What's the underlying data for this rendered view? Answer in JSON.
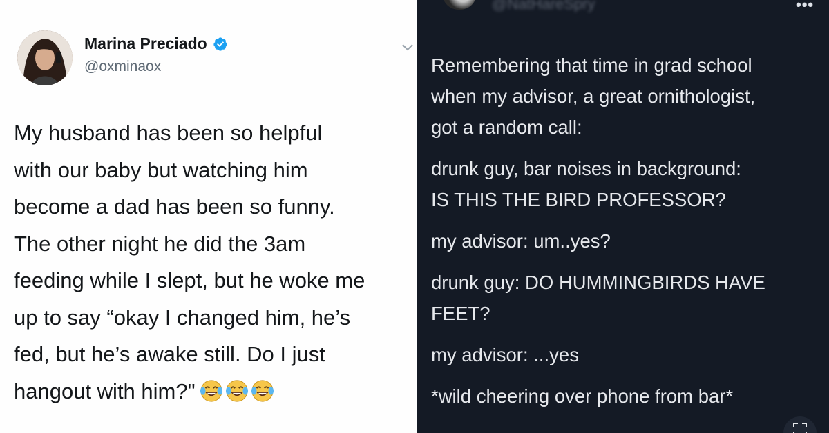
{
  "left_tweet": {
    "display_name": "Marina Preciado",
    "handle": "@oxminaox",
    "lines": [
      "My husband has been so helpful",
      "with our baby but watching him",
      "become a dad has been so funny.",
      "The other night he did the 3am",
      "feeding while I slept, but he woke me",
      "up to say “okay I changed him, he’s",
      "fed, but he’s awake still. Do I just",
      "hangout with him?\""
    ],
    "emoji": "face-with-tears-of-joy",
    "emoji_count": 3,
    "colors": {
      "text": "#14171a",
      "handle": "#5f6a75",
      "verified": "#1da1f2"
    }
  },
  "right_tweet": {
    "blurred_handle": "@NatHareSpry",
    "paragraphs": [
      [
        "Remembering that time in grad school",
        "when my advisor, a great ornithologist,",
        "got a random call:"
      ],
      [
        "drunk guy, bar noises in background:",
        "IS THIS THE BIRD PROFESSOR?"
      ],
      [
        "my advisor: um..yes?"
      ],
      [
        "drunk guy: DO HUMMINGBIRDS HAVE",
        "FEET?"
      ],
      [
        "my advisor: ...yes"
      ],
      [
        "*wild cheering over phone from bar*"
      ]
    ],
    "colors": {
      "background": "#141a25",
      "text": "#e6e8ec"
    }
  }
}
